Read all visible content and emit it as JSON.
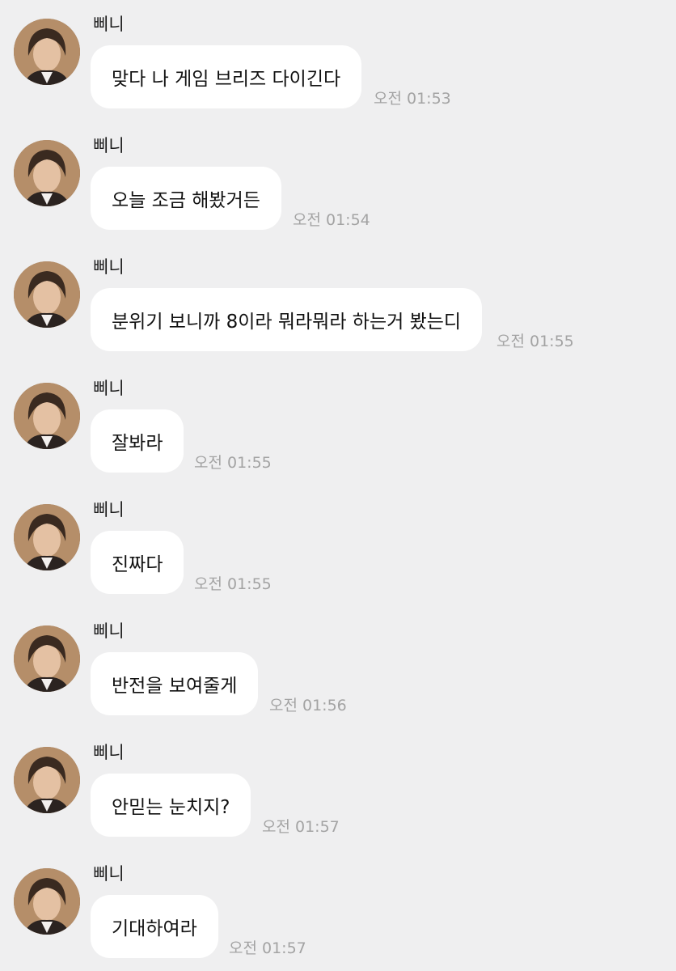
{
  "messages": [
    {
      "sender": "삐니",
      "text": "맞다 나 게임 브리즈 다이긴다",
      "time": "오전 01:53"
    },
    {
      "sender": "삐니",
      "text": "오늘 조금 해봤거든",
      "time": "오전 01:54"
    },
    {
      "sender": "삐니",
      "text": "분위기 보니까 8이라 뭐라뭐라 하는거 봤는디",
      "time": "오전 01:55"
    },
    {
      "sender": "삐니",
      "text": "잘봐라",
      "time": "오전 01:55"
    },
    {
      "sender": "삐니",
      "text": "진짜다",
      "time": "오전 01:55"
    },
    {
      "sender": "삐니",
      "text": "반전을 보여줄게",
      "time": "오전 01:56"
    },
    {
      "sender": "삐니",
      "text": "안믿는 눈치지?",
      "time": "오전 01:57"
    },
    {
      "sender": "삐니",
      "text": "기대하여라",
      "time": "오전 01:57"
    }
  ],
  "avatar": {
    "icon": "profile-photo",
    "colors": {
      "hair": "#3b2a20",
      "skin": "#e6c3a6",
      "background": "#b78f68"
    }
  },
  "colors": {
    "background": "#efeff0",
    "bubble": "#ffffff",
    "time": "#a3a3a3"
  }
}
